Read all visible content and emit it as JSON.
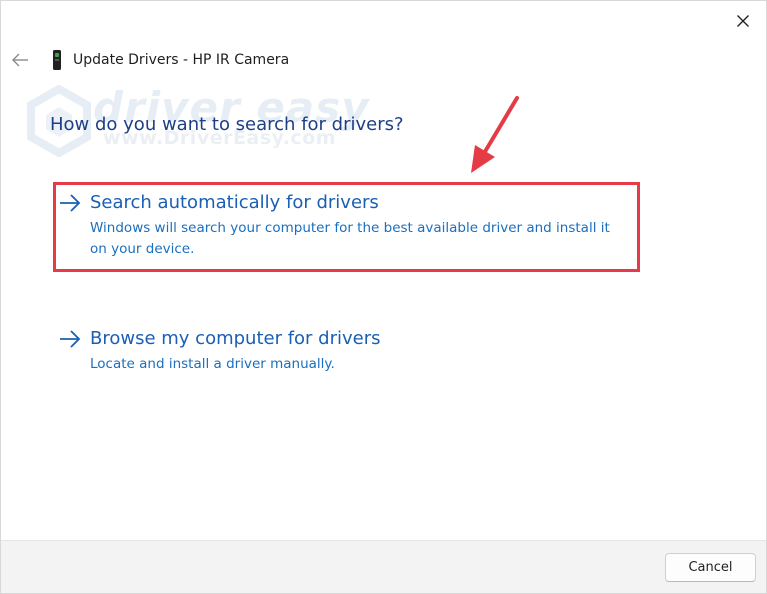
{
  "window": {
    "title": "Update Drivers - HP IR Camera",
    "close_icon": "close-icon",
    "back_icon": "back-arrow-icon",
    "device_icon": "camera-device-icon"
  },
  "watermark": {
    "brand": "driver easy",
    "url": "www.DriverEasy.com"
  },
  "main": {
    "heading": "How do you want to search for drivers?",
    "options": [
      {
        "title": "Search automatically for drivers",
        "description": "Windows will search your computer for the best available driver and install it on your device.",
        "icon": "arrow-right-icon",
        "highlighted": true
      },
      {
        "title": "Browse my computer for drivers",
        "description": "Locate and install a driver manually.",
        "icon": "arrow-right-icon",
        "highlighted": false
      }
    ]
  },
  "footer": {
    "cancel_label": "Cancel"
  },
  "colors": {
    "heading": "#1d3f86",
    "link": "#1a5fb4",
    "annotation": "#e53b47",
    "footer_bg": "#f3f3f3"
  }
}
